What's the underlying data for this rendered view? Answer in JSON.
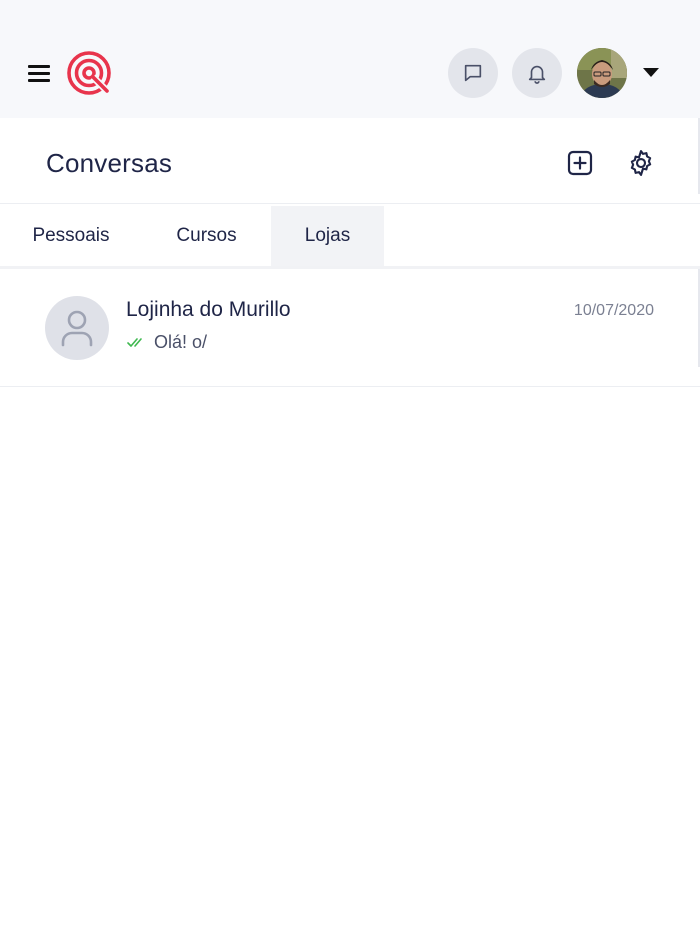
{
  "topbar": {
    "icons": {
      "menu": "hamburger-menu-icon",
      "logo": "brand-logo",
      "chat": "chat-bubble-icon",
      "notifications": "bell-icon",
      "profile": "user-avatar",
      "dropdown": "caret-down-icon"
    },
    "colors": {
      "brand": "#e8344c",
      "bar_bg": "#f7f8fb",
      "button_bg": "#e3e5eb"
    }
  },
  "header": {
    "title": "Conversas",
    "actions": {
      "new": "add-square-icon",
      "settings": "gear-icon"
    }
  },
  "tabs": [
    {
      "label": "Pessoais",
      "active": false
    },
    {
      "label": "Cursos",
      "active": false
    },
    {
      "label": "Lojas",
      "active": true
    }
  ],
  "conversations": [
    {
      "name": "Lojinha do Murillo",
      "date": "10/07/2020",
      "last_message": "Olá! o/",
      "status": "read",
      "status_color": "#3fb950",
      "avatar_icon": "default-user-icon"
    }
  ]
}
